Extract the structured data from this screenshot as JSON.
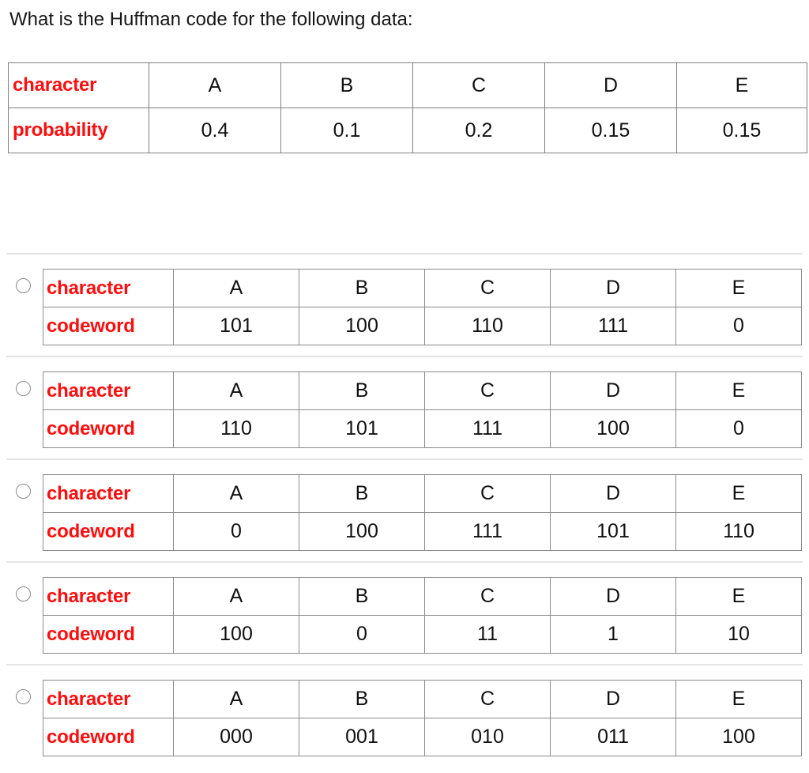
{
  "question": {
    "prompt": "What is the Huffman code for the following data:",
    "table": {
      "row_labels": [
        "character",
        "probability"
      ],
      "characters": [
        "A",
        "B",
        "C",
        "D",
        "E"
      ],
      "probabilities": [
        "0.4",
        "0.1",
        "0.2",
        "0.15",
        "0.15"
      ]
    }
  },
  "answer_options": [
    {
      "id": "option-a",
      "selected": false,
      "row_labels": [
        "character",
        "codeword"
      ],
      "characters": [
        "A",
        "B",
        "C",
        "D",
        "E"
      ],
      "codewords": [
        "101",
        "100",
        "110",
        "111",
        "0"
      ]
    },
    {
      "id": "option-b",
      "selected": false,
      "row_labels": [
        "character",
        "codeword"
      ],
      "characters": [
        "A",
        "B",
        "C",
        "D",
        "E"
      ],
      "codewords": [
        "110",
        "101",
        "111",
        "100",
        "0"
      ]
    },
    {
      "id": "option-c",
      "selected": false,
      "row_labels": [
        "character",
        "codeword"
      ],
      "characters": [
        "A",
        "B",
        "C",
        "D",
        "E"
      ],
      "codewords": [
        "0",
        "100",
        "111",
        "101",
        "110"
      ]
    },
    {
      "id": "option-d",
      "selected": false,
      "row_labels": [
        "character",
        "codeword"
      ],
      "characters": [
        "A",
        "B",
        "C",
        "D",
        "E"
      ],
      "codewords": [
        "100",
        "0",
        "11",
        "1",
        "10"
      ]
    },
    {
      "id": "option-e",
      "selected": false,
      "row_labels": [
        "character",
        "codeword"
      ],
      "characters": [
        "A",
        "B",
        "C",
        "D",
        "E"
      ],
      "codewords": [
        "000",
        "001",
        "010",
        "011",
        "100"
      ]
    }
  ],
  "colors": {
    "label_red": "#ff0d0d",
    "text_black": "#111111",
    "table_border": "#808080",
    "separator_gray": "#e4e4e4",
    "radio_border": "#898989"
  }
}
